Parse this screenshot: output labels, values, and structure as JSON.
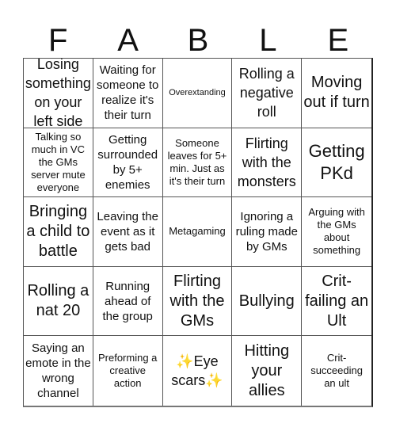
{
  "header": {
    "letters": [
      "F",
      "A",
      "B",
      "L",
      "E"
    ]
  },
  "board": {
    "cells": [
      "Losing something on your left side",
      "Waiting for someone to realize it's their turn",
      "Overextanding",
      "Rolling a negative roll",
      "Moving out if turn",
      "Talking so much in VC the GMs server mute everyone",
      "Getting surrounded by 5+ enemies",
      "Someone leaves for 5+ min. Just as it's their turn",
      "Flirting with the monsters",
      "Getting PKd",
      "Bringing a child to battle",
      "Leaving the event as it gets bad",
      "Metagaming",
      "Ignoring a ruling made by GMs",
      "Arguing with the GMs about something",
      "Rolling a nat 20",
      "Running ahead of the group",
      "Flirting with the GMs",
      "Bullying",
      "Crit-failing an Ult",
      "Saying an emote in the wrong channel",
      "Preforming a creative action",
      "✨Eye scars✨",
      "Hitting your allies",
      "Crit-succeeding an ult"
    ]
  }
}
